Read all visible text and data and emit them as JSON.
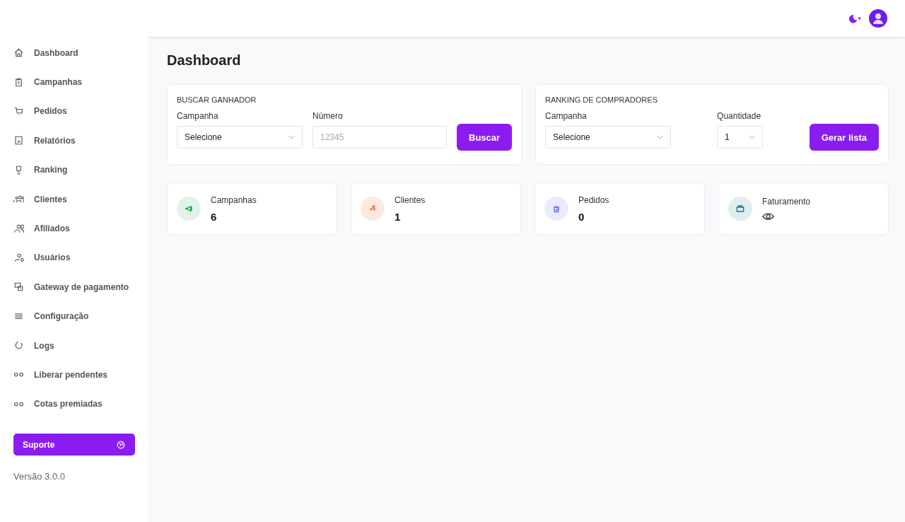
{
  "sidebar": {
    "items": [
      {
        "label": "Dashboard"
      },
      {
        "label": "Campanhas"
      },
      {
        "label": "Pedidos"
      },
      {
        "label": "Relatórios"
      },
      {
        "label": "Ranking"
      },
      {
        "label": "Clientes"
      },
      {
        "label": "Afiliados"
      },
      {
        "label": "Usuários"
      },
      {
        "label": "Gateway de pagamento"
      },
      {
        "label": "Configuração"
      },
      {
        "label": "Logs"
      },
      {
        "label": "Liberar pendentes"
      },
      {
        "label": "Cotas premiadas"
      }
    ],
    "support_button": "Suporte",
    "version": "Versão 3.0.0"
  },
  "page_title": "Dashboard",
  "panels": [
    {
      "title": "BUSCAR GANHADOR",
      "fields": [
        {
          "kind": "select",
          "label": "Campanha",
          "value": "Selecione"
        },
        {
          "kind": "input",
          "label": "Número",
          "placeholder": "12345"
        }
      ],
      "button": "Buscar"
    },
    {
      "title": "RANKING DE COMPRADORES",
      "fields": [
        {
          "kind": "select",
          "label": "Campanha",
          "value": "Selecione"
        },
        {
          "kind": "small-select",
          "label": "Quantidade",
          "value": "1"
        }
      ],
      "button": "Gerar lista"
    }
  ],
  "stats": [
    {
      "label": "Campanhas",
      "kind": "number",
      "value": "6",
      "color": "#16a34a"
    },
    {
      "label": "Clientes",
      "kind": "number",
      "value": "1",
      "color": "#ea580c"
    },
    {
      "label": "Pedidos",
      "kind": "number",
      "value": "0",
      "color": "#6366f1"
    },
    {
      "label": "Faturamento",
      "kind": "hidden",
      "color": "#0e7490"
    }
  ]
}
